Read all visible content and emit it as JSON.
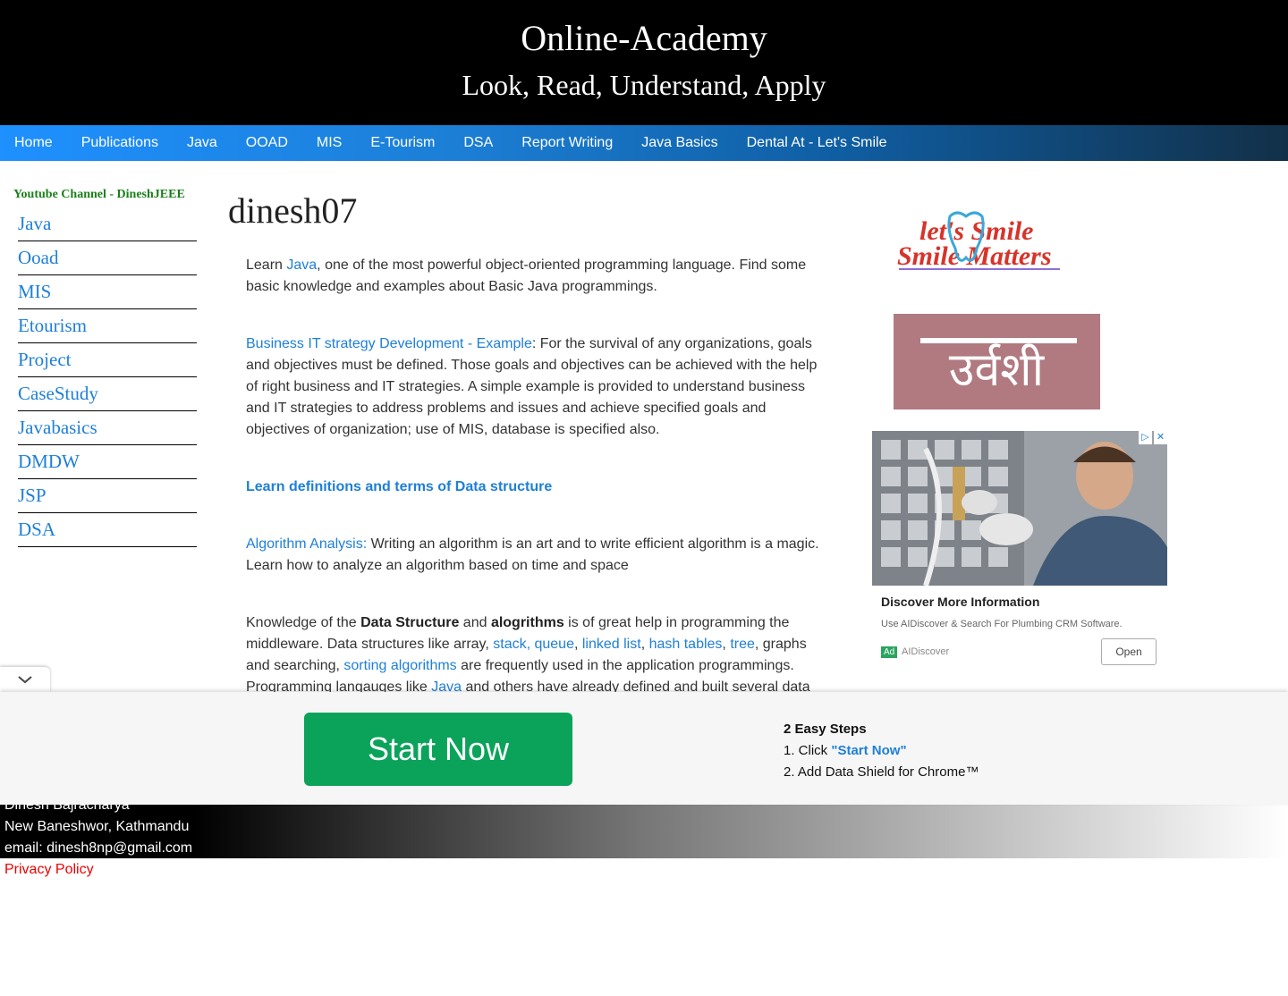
{
  "header": {
    "title": "Online-Academy",
    "tagline": "Look, Read, Understand, Apply"
  },
  "nav": {
    "items": [
      "Home",
      "Publications",
      "Java",
      "OOAD",
      "MIS",
      "E-Tourism",
      "DSA",
      "Report Writing",
      "Java Basics",
      "Dental At - Let's Smile"
    ]
  },
  "sidebar": {
    "youtube": "Youtube Channel - DineshJEEE",
    "items": [
      "Java",
      "Ooad",
      "MIS",
      "Etourism",
      "Project",
      "CaseStudy",
      "Javabasics",
      "DMDW",
      "JSP",
      "DSA"
    ]
  },
  "main": {
    "title": "dinesh07",
    "p1": {
      "pre": "Learn ",
      "link": "Java",
      "post": ", one of the most powerful object-oriented programming language. Find some basic knowledge and examples about Basic Java programmings."
    },
    "p2": {
      "link": "Business IT strategy Development - Example",
      "post": ": For the survival of any organizations, goals and objectives must be defined. Those goals and objectives can be achieved with the help of right business and IT strategies. A simple example is provided to understand business and IT strategies to address problems and issues and achieve specified goals and objectives of organization; use of MIS, database is specified also."
    },
    "p3": {
      "link": "Learn definitions and terms of Data structure"
    },
    "p4": {
      "link": "Algorithm Analysis:",
      "post": " Writing an algorithm is an art and to write efficient algorithm is a magic. Learn how to analyze an algorithm based on time and space"
    },
    "p5": {
      "t1": "Knowledge of the ",
      "b1": "Data Structure",
      "t2": " and ",
      "b2": "alogrithms",
      "t3": " is of great help in programming the middleware. Data structures like array, ",
      "l1": "stack, queue",
      "t4": ", ",
      "l2": "linked list",
      "t5": ", ",
      "l3": "hash tables",
      "t6": ", ",
      "l4": "tree",
      "t7": ", graphs and searching, ",
      "l5": "sorting algorithms",
      "t8": " are frequently used in the application programmings. Programming langauges like ",
      "l6": "Java",
      "t9": " and others have already defined and built several data"
    }
  },
  "ads": {
    "logo_text": "let's Smile Smile Matters",
    "urvashi_text": "उर्वशी",
    "card": {
      "title": "Discover More Information",
      "desc": "Use AIDiscover & Search For Plumbing CRM Software.",
      "badge": "Ad",
      "brand": "AIDiscover",
      "open": "Open"
    }
  },
  "footer": {
    "name": "Dinesh Bajracharya",
    "address": "New Baneshwor, Kathmandu",
    "email": "email: dinesh8np@gmail.com",
    "privacy": "Privacy Policy"
  },
  "banner": {
    "button": "Start Now",
    "steps_title": "2 Easy Steps",
    "step1_pre": "1. Click ",
    "step1_hl": "\"Start Now\"",
    "step2": "2. Add Data Shield for Chrome™"
  }
}
